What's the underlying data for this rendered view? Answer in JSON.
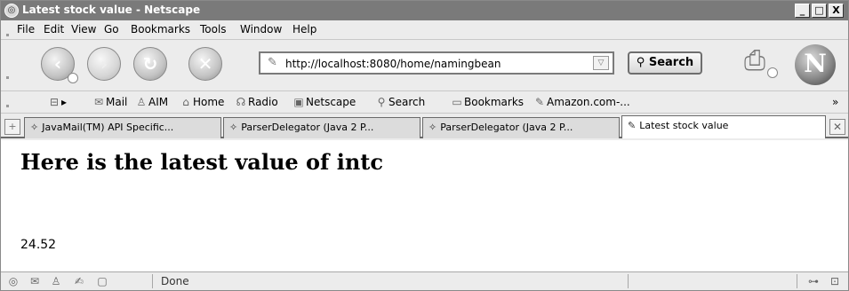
{
  "window": {
    "title": "Latest stock value - Netscape",
    "minimize": "_",
    "maximize": "□",
    "close": "X"
  },
  "menu": [
    "File",
    "Edit",
    "View",
    "Go",
    "Bookmarks",
    "Tools",
    "Window",
    "Help"
  ],
  "navigation": {
    "back_icon": "‹",
    "forward_icon": "›",
    "reload_icon": "↻",
    "stop_icon": "✕",
    "url_value": "http://localhost:8080/home/namingbean",
    "search_label": "Search",
    "logo_letter": "N"
  },
  "personal_toolbar": {
    "items": [
      "Mail",
      "AIM",
      "Home",
      "Radio",
      "Netscape",
      "Search",
      "Bookmarks",
      "Amazon.com-..."
    ],
    "overflow": "»"
  },
  "tabs": [
    {
      "label": "JavaMail(TM) API Specific..."
    },
    {
      "label": "ParserDelegator (Java 2 P..."
    },
    {
      "label": "ParserDelegator (Java 2 P..."
    },
    {
      "label": "Latest stock value"
    }
  ],
  "content": {
    "heading": "Here is the latest value of intc",
    "value": "24.52"
  },
  "status": {
    "text": "Done"
  },
  "colors": {
    "titlebar": "#7a7a7a",
    "chrome": "#ececec",
    "page_bg": "#ffffff"
  }
}
